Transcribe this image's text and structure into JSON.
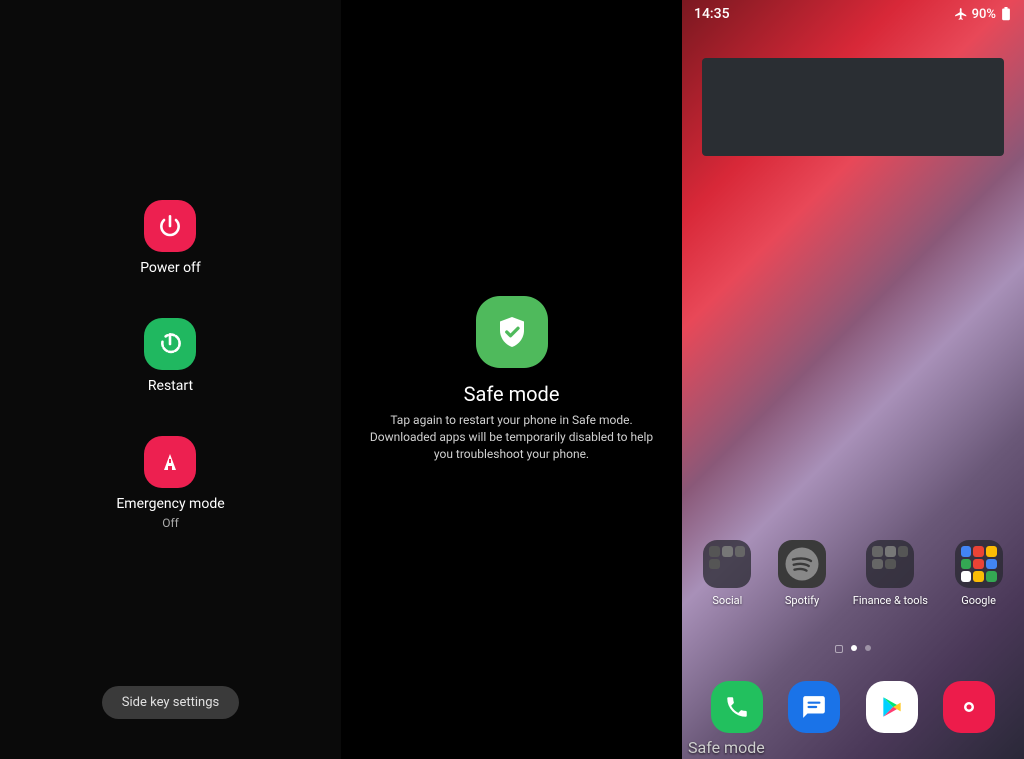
{
  "panel1": {
    "power_off": "Power off",
    "restart": "Restart",
    "emergency": "Emergency mode",
    "emergency_sub": "Off",
    "side_key": "Side key settings"
  },
  "panel2": {
    "title": "Safe mode",
    "desc": "Tap again to restart your phone in Safe mode. Downloaded apps will be temporarily disabled to help you troubleshoot your phone."
  },
  "panel3": {
    "time": "14:35",
    "battery": "90%",
    "apps": {
      "social": "Social",
      "spotify": "Spotify",
      "finance": "Finance & tools",
      "google": "Google"
    },
    "safe_mode_label": "Safe mode"
  }
}
